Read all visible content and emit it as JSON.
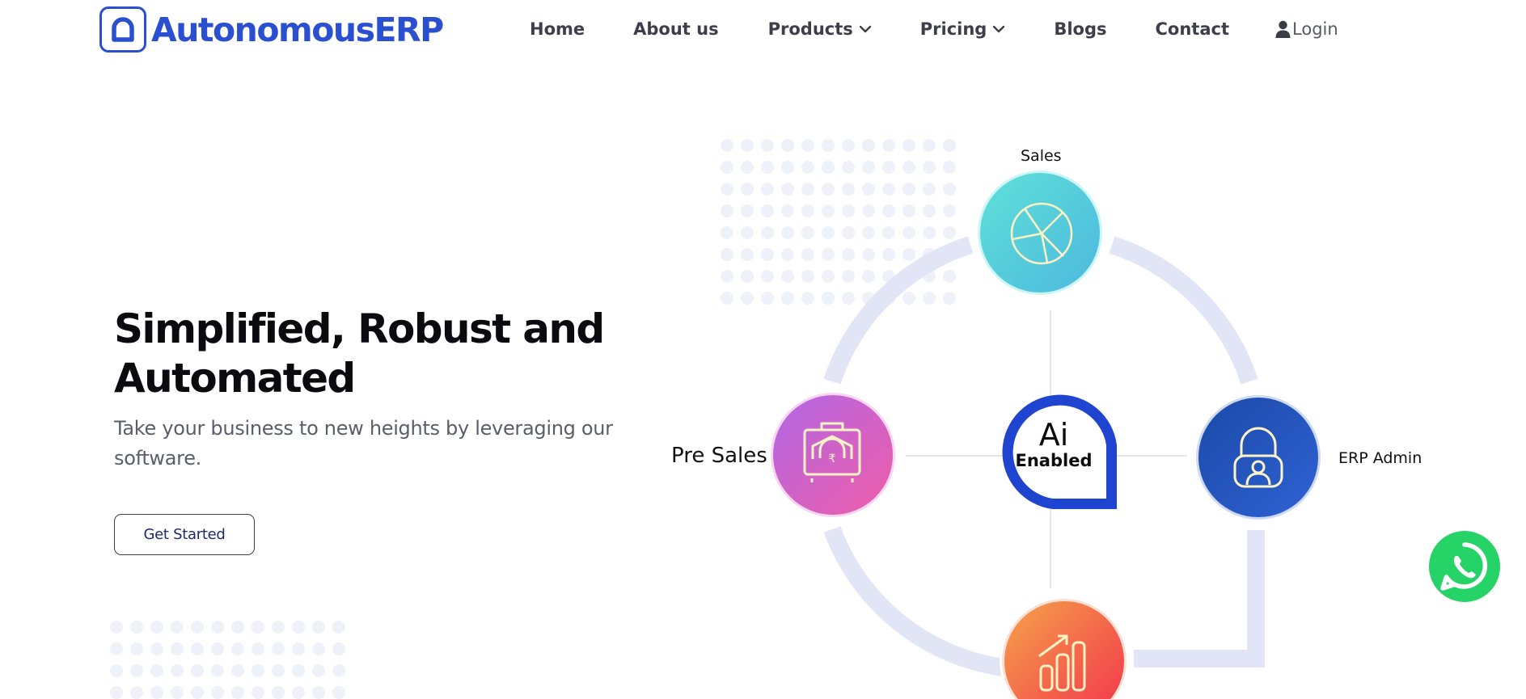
{
  "brand": {
    "name": "AutonomousERP",
    "color": "#2b4fd1"
  },
  "nav": {
    "items": [
      {
        "label": "Home",
        "dropdown": false
      },
      {
        "label": "About us",
        "dropdown": false
      },
      {
        "label": "Products",
        "dropdown": true
      },
      {
        "label": "Pricing",
        "dropdown": true
      },
      {
        "label": "Blogs",
        "dropdown": false
      },
      {
        "label": "Contact",
        "dropdown": false
      }
    ],
    "login": {
      "label": "Login",
      "icon": "user-icon"
    }
  },
  "hero": {
    "title_line1": "Simplified, Robust and",
    "title_line2": "Automated",
    "subtitle": "Take your business to new heights by leveraging our software.",
    "cta_label": "Get Started"
  },
  "diagram": {
    "center": {
      "main": "Ai",
      "sub": "Enabled",
      "color": "#1f44d0"
    },
    "nodes": [
      {
        "label": "Sales",
        "icon": "pie-chart-icon",
        "color": "#4ec9d9"
      },
      {
        "label": "Pre Sales",
        "icon": "briefcase-rupee-icon",
        "color": "#c662d9"
      },
      {
        "label": "ERP Admin",
        "icon": "user-lock-icon",
        "color": "#2453b8"
      },
      {
        "label": "",
        "icon": "growth-chart-icon",
        "color": "#f05a3f"
      }
    ],
    "ring_color": "#e1e5f6"
  },
  "floating": {
    "whatsapp_icon": "whatsapp-icon",
    "whatsapp_color": "#25d366"
  }
}
